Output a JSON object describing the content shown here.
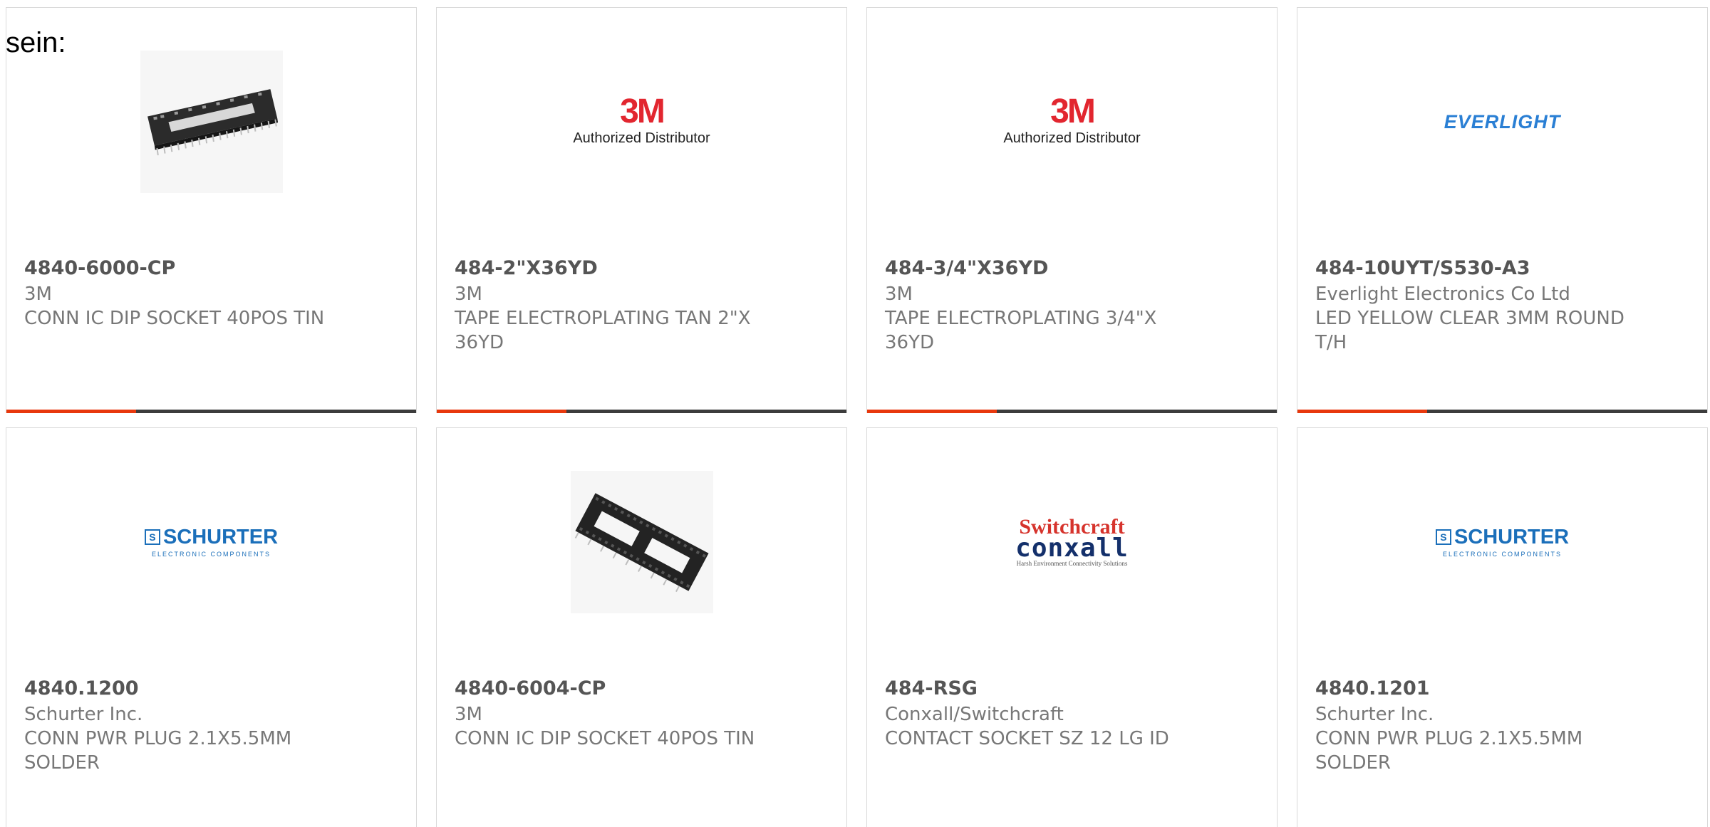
{
  "intro_text": "sein:",
  "colors": {
    "accent_bar": "#e8380d",
    "bar_dark": "#3c3c3c",
    "brand_3m": "#e2262f",
    "brand_everlight": "#2a7fd4",
    "brand_schurter": "#1b6fba"
  },
  "products": [
    {
      "part_number": "4840-6000-CP",
      "manufacturer": "3M",
      "description": "CONN IC DIP SOCKET 40POS TIN",
      "image": "dip-socket-photo"
    },
    {
      "part_number": "484-2\"X36YD",
      "manufacturer": "3M",
      "description": "TAPE ELECTROPLATING TAN 2\"X 36YD",
      "image": "3m-logo",
      "logo_text": "3M",
      "logo_subtext": "Authorized Distributor"
    },
    {
      "part_number": "484-3/4\"X36YD",
      "manufacturer": "3M",
      "description": "TAPE ELECTROPLATING 3/4\"X 36YD",
      "image": "3m-logo",
      "logo_text": "3M",
      "logo_subtext": "Authorized Distributor"
    },
    {
      "part_number": "484-10UYT/S530-A3",
      "manufacturer": "Everlight Electronics Co Ltd",
      "description": "LED YELLOW CLEAR 3MM ROUND T/H",
      "image": "everlight-logo",
      "logo_text": "EVERLIGHT"
    },
    {
      "part_number": "4840.1200",
      "manufacturer": "Schurter Inc.",
      "description": "CONN PWR PLUG 2.1X5.5MM SOLDER",
      "image": "schurter-logo",
      "logo_text": "SCHURTER",
      "logo_mark": "S",
      "logo_subtext": "ELECTRONIC COMPONENTS"
    },
    {
      "part_number": "4840-6004-CP",
      "manufacturer": "3M",
      "description": "CONN IC DIP SOCKET 40POS TIN",
      "image": "dip-socket-angled-photo"
    },
    {
      "part_number": "484-RSG",
      "manufacturer": "Conxall/Switchcraft",
      "description": "CONTACT SOCKET SZ 12 LG ID",
      "image": "switchcraft-conxall-logo",
      "logo_text": "Switchcraft",
      "logo_text_2": "conxall",
      "logo_subtext": "Harsh Environment Connectivity Solutions"
    },
    {
      "part_number": "4840.1201",
      "manufacturer": "Schurter Inc.",
      "description": "CONN PWR PLUG 2.1X5.5MM SOLDER",
      "image": "schurter-logo",
      "logo_text": "SCHURTER",
      "logo_mark": "S",
      "logo_subtext": "ELECTRONIC COMPONENTS"
    }
  ]
}
